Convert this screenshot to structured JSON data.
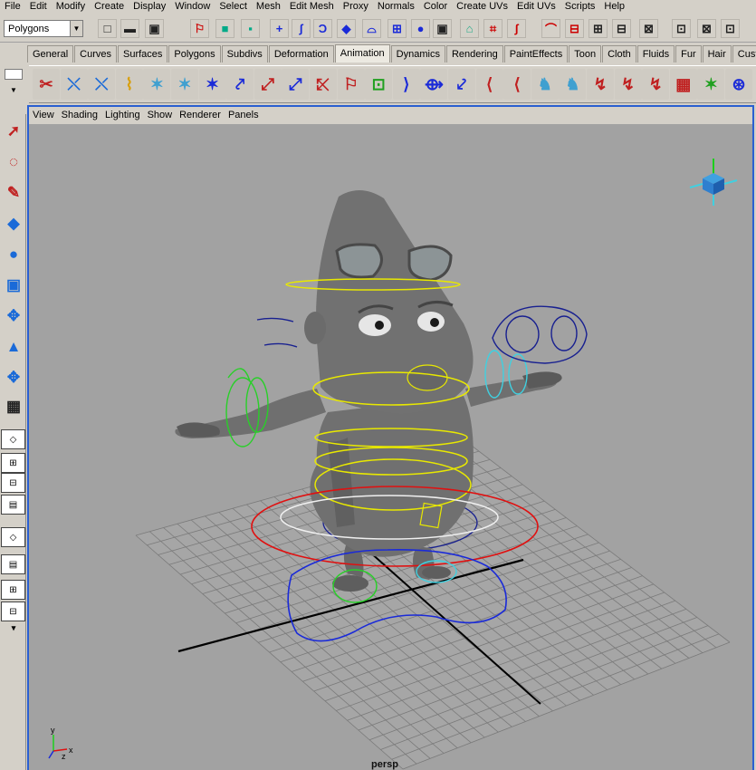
{
  "menubar": {
    "items": [
      "File",
      "Edit",
      "Modify",
      "Create",
      "Display",
      "Window",
      "Select",
      "Mesh",
      "Edit Mesh",
      "Proxy",
      "Normals",
      "Color",
      "Create UVs",
      "Edit UVs",
      "Scripts",
      "Help"
    ]
  },
  "statusline": {
    "mode": "Polygons"
  },
  "shelf": {
    "tabs": [
      "General",
      "Curves",
      "Surfaces",
      "Polygons",
      "Subdivs",
      "Deformation",
      "Animation",
      "Dynamics",
      "Rendering",
      "PaintEffects",
      "Toon",
      "Cloth",
      "Fluids",
      "Fur",
      "Hair",
      "Cust"
    ],
    "active_tab": "Animation"
  },
  "panel": {
    "menu": [
      "View",
      "Shading",
      "Lighting",
      "Show",
      "Renderer",
      "Panels"
    ],
    "camera_label": "persp",
    "axis_labels": {
      "x": "x",
      "y": "y",
      "z": "z"
    }
  },
  "colors": {
    "panel_border": "#2a5fd1",
    "viewport_bg": "#a2a2a2",
    "ui_bg": "#d4d0c8",
    "grid": "#7a7a7a",
    "ctrl_red": "#e01010",
    "ctrl_yellow": "#e8e800",
    "ctrl_blue": "#1a2ad8",
    "ctrl_green": "#28d028",
    "ctrl_cyan": "#40d0e0",
    "ctrl_navy": "#182090"
  },
  "icons": {
    "statusline": [
      "new-scene-icon",
      "open-scene-icon",
      "save-scene-icon",
      "select-hierarchy-icon",
      "select-object-icon",
      "select-component-icon",
      "select-by-handle-icon",
      "select-by-joint-icon",
      "select-by-curve-icon",
      "select-by-surface-icon",
      "select-by-deformation-icon",
      "select-by-dynamic-icon",
      "select-by-render-icon",
      "lock-selection-icon",
      "highlight-selection-icon",
      "snap-to-grid-icon",
      "snap-to-curve-icon",
      "snap-to-point-icon",
      "snap-to-view-plane-icon",
      "make-live-icon",
      "input-ops-icon",
      "output-ops-icon",
      "construction-history-icon"
    ],
    "shelf": [
      "set-key-icon",
      "ik-handle-icon",
      "joint-tool-icon",
      "skin-icon",
      "character-icon",
      "humanik-icon",
      "bind-pose-icon",
      "connect-joint-icon",
      "mirror-joint-icon",
      "orient-joint-icon",
      "reroot-icon",
      "remove-joint-icon",
      "lattice-icon",
      "cluster-icon",
      "wire-icon",
      "sculpt-icon",
      "nonlinear-icon",
      "bend-icon",
      "blue-figure-icon",
      "figure-pair-icon",
      "bind-skin-icon",
      "detach-skin-icon",
      "paint-weights-icon",
      "graph-editor-icon",
      "star-icon",
      "ring-icon"
    ],
    "toolbox": [
      "select-tool-icon",
      "lasso-tool-icon",
      "paint-select-icon",
      "move-tool-icon",
      "rotate-tool-icon",
      "scale-tool-icon",
      "manipulator-icon",
      "soft-mod-icon",
      "show-manipulator-icon",
      "last-tool-icon"
    ]
  }
}
